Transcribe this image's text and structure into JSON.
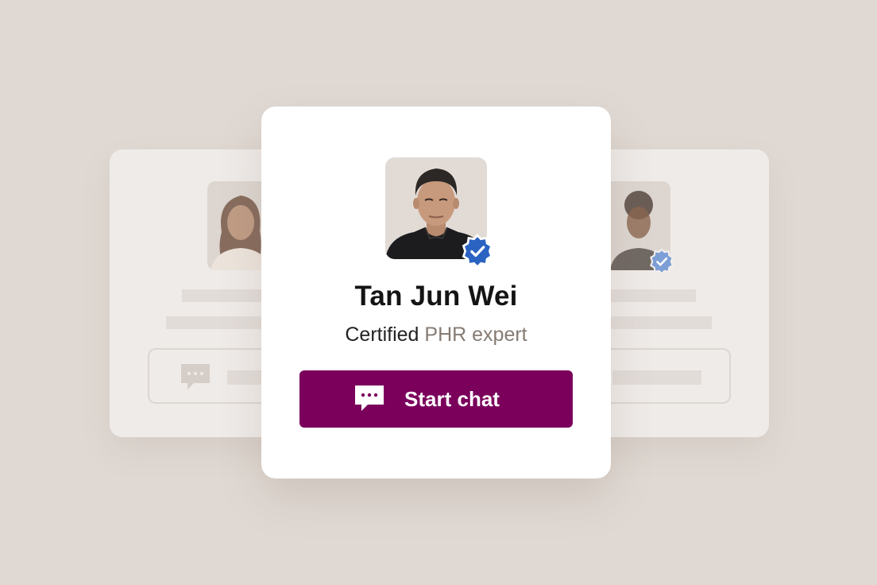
{
  "expert": {
    "name": "Tan Jun Wei",
    "title_prefix": "Certified",
    "title_highlight": "PHR expert",
    "verified": true
  },
  "actions": {
    "start_chat_label": "Start chat"
  },
  "colors": {
    "background": "#e0d9d3",
    "card": "#ffffff",
    "primary_button": "#7a005c",
    "verified_badge": "#2b63c2",
    "faded_badge": "#7d9fd6",
    "muted_text": "#857b73"
  },
  "icons": {
    "verified": "verified-badge-icon",
    "chat": "chat-bubble-icon"
  }
}
